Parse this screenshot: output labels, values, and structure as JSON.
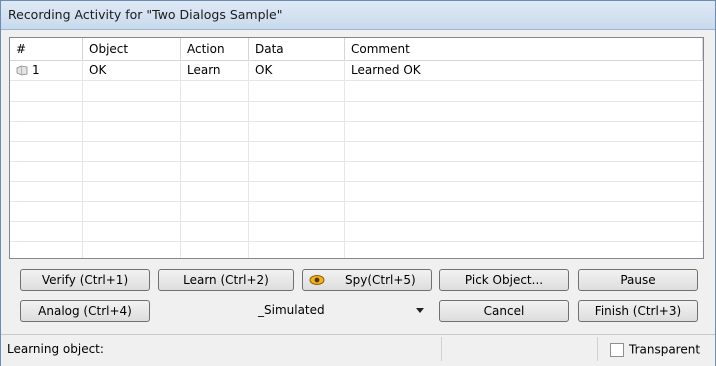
{
  "window": {
    "title": "Recording Activity for \"Two Dialogs Sample\""
  },
  "grid": {
    "columns": [
      "#",
      "Object",
      "Action",
      "Data",
      "Comment"
    ],
    "rows": [
      {
        "index": "1",
        "object": "OK",
        "action": "Learn",
        "data": "OK",
        "comment": "Learned OK",
        "icon": "step-icon"
      }
    ]
  },
  "buttons": {
    "verify": "Verify (Ctrl+1)",
    "learn": "Learn (Ctrl+2)",
    "spy": "Spy(Ctrl+5)",
    "pick_object": "Pick Object...",
    "pause": "Pause",
    "analog": "Analog (Ctrl+4)",
    "cancel": "Cancel",
    "finish": "Finish (Ctrl+3)"
  },
  "mode_dropdown": {
    "selected": "_Simulated"
  },
  "status": {
    "text": "Learning object:",
    "transparent_label": "Transparent",
    "transparent_checked": false
  },
  "icons": {
    "spy": "eye-icon",
    "row": "step-icon",
    "dropdown": "chevron-down-icon"
  }
}
